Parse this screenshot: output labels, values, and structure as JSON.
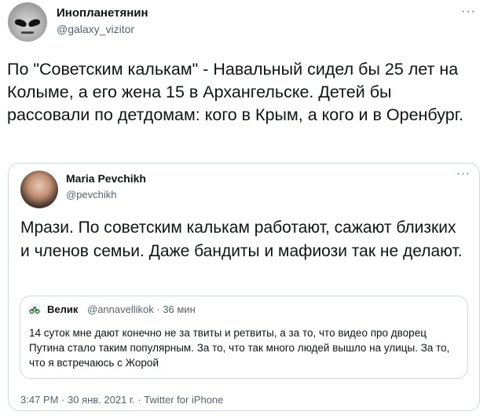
{
  "tweet": {
    "name": "Инопланетянин",
    "handle": "@galaxy_vizitor",
    "more": "···",
    "text": "По \"Советским калькам\" - Навальный сидел бы 25 лет на Колыме, а его жена 15 в Архангельске. Детей бы рассовали по детдомам: кого в Крым, а кого и в Оренбург."
  },
  "quote": {
    "name": "Maria Pevchikh",
    "handle": "@pevchikh",
    "more": "···",
    "text": "Мрази. По советским калькам работают, сажают близких и членов семьи. Даже бандиты и мафиози так не делают.",
    "inner": {
      "name": "Велик",
      "meta": "@annavellikok · 36 мин",
      "text": "14 суток мне дают конечно не за твиты и ретвиты, а за то, что видео про дворец Путина стало таким популярным. За то, что так много людей вышло на улицы. За то, что я встречаюсь с Жорой"
    },
    "footer": "3:47 PM · 30 янв. 2021 г. · Twitter for iPhone"
  }
}
